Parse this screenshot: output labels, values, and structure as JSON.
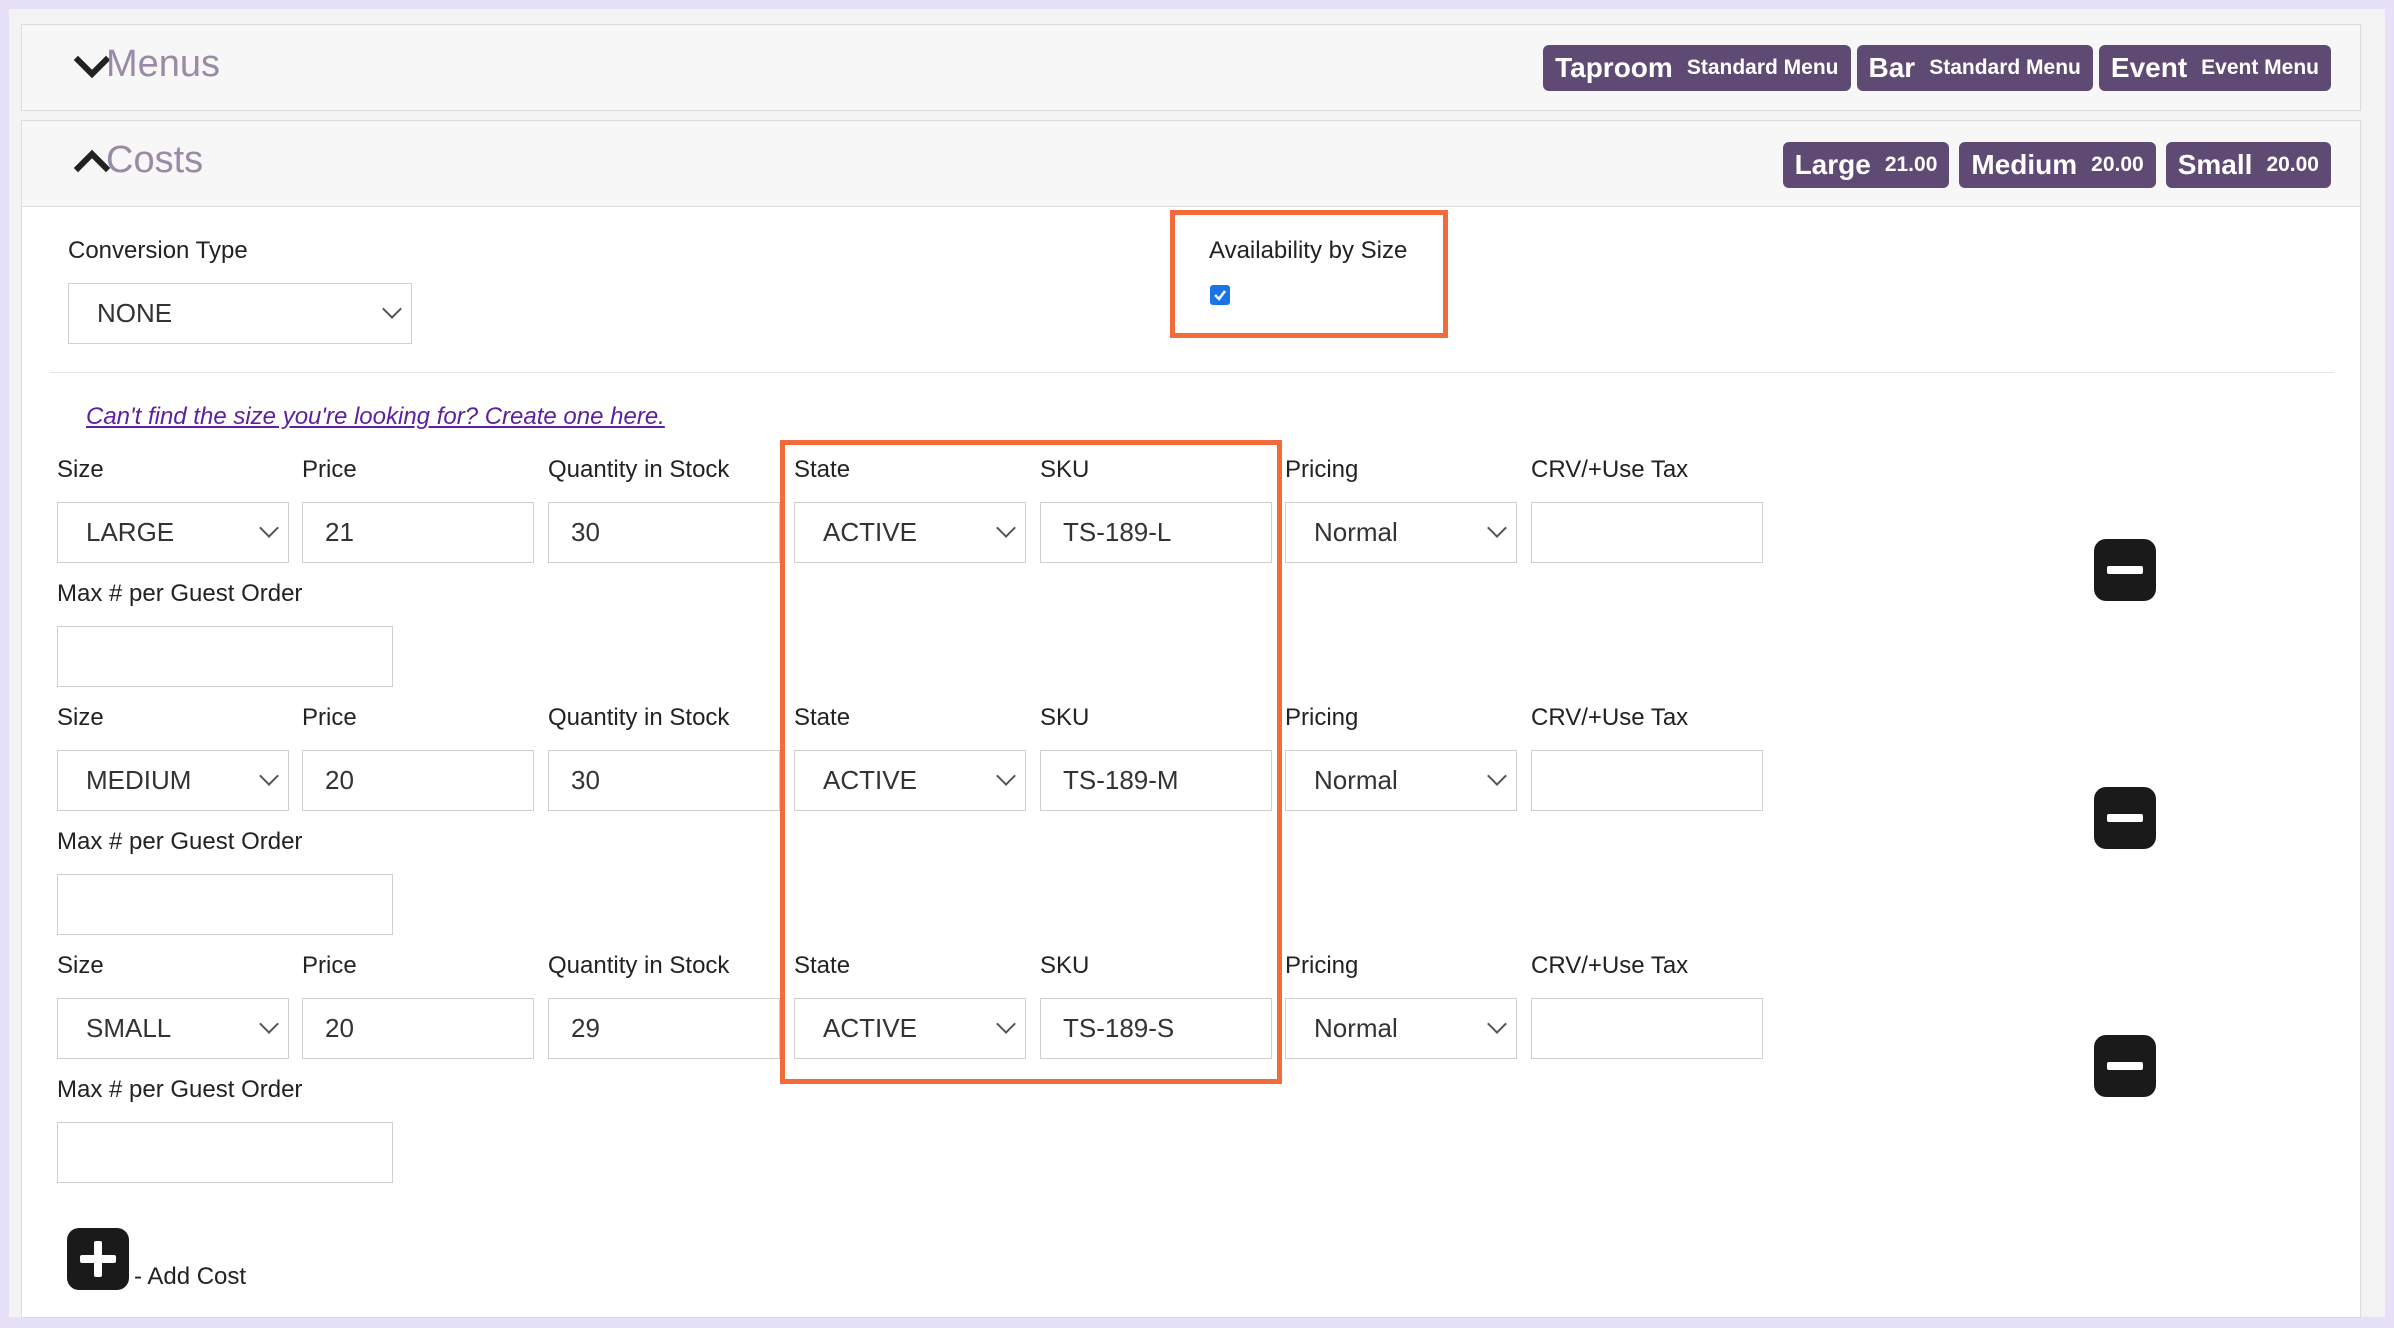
{
  "menus": {
    "title": "Menus",
    "tags": [
      {
        "name": "Taproom",
        "sub": "Standard Menu"
      },
      {
        "name": "Bar",
        "sub": "Standard Menu"
      },
      {
        "name": "Event",
        "sub": "Event Menu"
      }
    ]
  },
  "costs": {
    "title": "Costs",
    "tags": [
      {
        "name": "Large",
        "value": "21.00"
      },
      {
        "name": "Medium",
        "value": "20.00"
      },
      {
        "name": "Small",
        "value": "20.00"
      }
    ],
    "conversion_label": "Conversion Type",
    "conversion_value": "NONE",
    "availability_label": "Availability by Size",
    "availability_checked": true,
    "create_link": "Can't find the size you're looking for? Create one here.",
    "field_labels": {
      "size": "Size",
      "price": "Price",
      "qty": "Quantity in Stock",
      "state": "State",
      "sku": "SKU",
      "pricing": "Pricing",
      "crv": "CRV/+Use Tax",
      "max": "Max # per Guest Order"
    },
    "rows": [
      {
        "size": "LARGE",
        "price": "21",
        "qty": "30",
        "state": "ACTIVE",
        "sku": "TS-189-L",
        "pricing": "Normal",
        "crv": "",
        "max": ""
      },
      {
        "size": "MEDIUM",
        "price": "20",
        "qty": "30",
        "state": "ACTIVE",
        "sku": "TS-189-M",
        "pricing": "Normal",
        "crv": "",
        "max": ""
      },
      {
        "size": "SMALL",
        "price": "20",
        "qty": "29",
        "state": "ACTIVE",
        "sku": "TS-189-S",
        "pricing": "Normal",
        "crv": "",
        "max": ""
      }
    ],
    "add_cost_label": "- Add Cost"
  },
  "colors": {
    "tag_bg": "#5f4a74",
    "highlight": "#f36b3a",
    "link": "#5b1fa0",
    "title": "#9a8aa6"
  }
}
